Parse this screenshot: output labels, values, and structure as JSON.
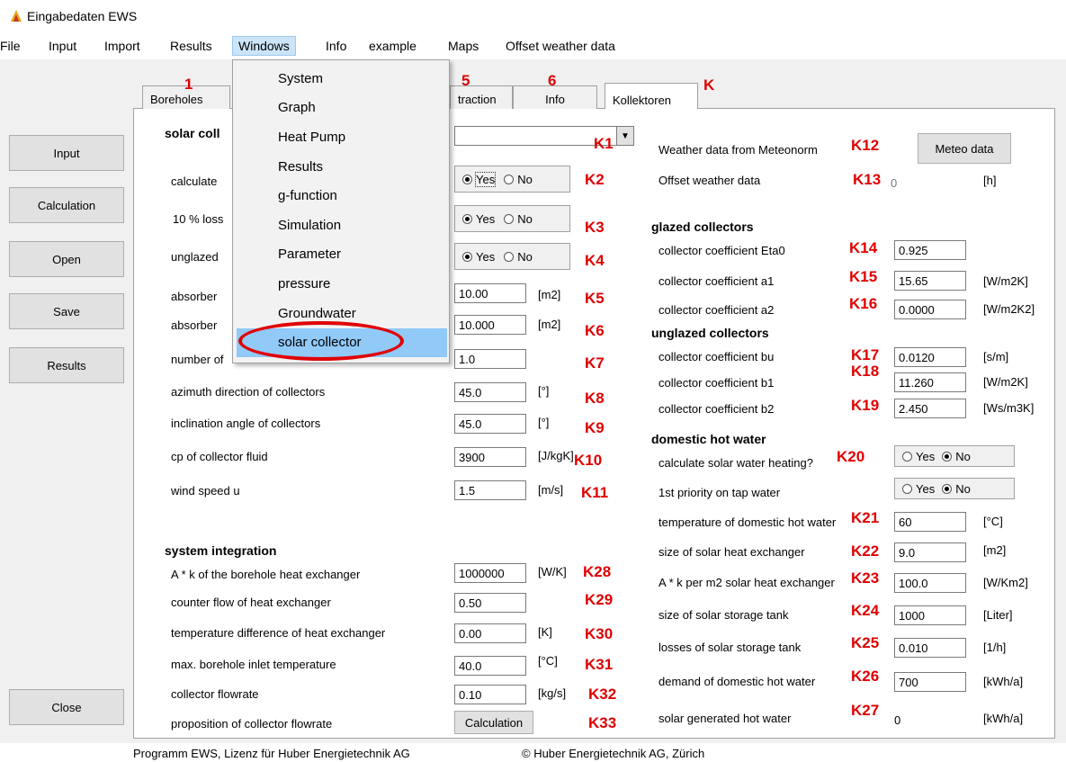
{
  "window": {
    "title": "Eingabedaten EWS"
  },
  "menu": [
    "File",
    "Input",
    "Import",
    "Results",
    "Windows",
    "Info",
    "example",
    "Maps",
    "Offset weather data"
  ],
  "windows_menu": [
    "System",
    "Graph",
    "Heat Pump",
    "Results",
    "g-function",
    "Simulation",
    "Parameter",
    "pressure",
    "Groundwater",
    "solar collector"
  ],
  "sidebar": {
    "input": "Input",
    "calculation": "Calculation",
    "open": "Open",
    "save": "Save",
    "results": "Results",
    "close": "Close"
  },
  "tabs": [
    "Boreholes",
    "traction",
    "Info",
    "Kollektoren"
  ],
  "tab_annotations": {
    "boreholes": "1",
    "traction": "5",
    "info": "6",
    "kollektoren": "K"
  },
  "left": {
    "section_title": "solar coll",
    "k1": "K1",
    "calculate": {
      "label": "calculate",
      "yes": "Yes",
      "no": "No",
      "anno": "K2",
      "selected": "Yes"
    },
    "loss": {
      "label": "10 % loss",
      "yes": "Yes",
      "no": "No",
      "anno": "K3",
      "selected": "Yes"
    },
    "unglazed": {
      "label": "unglazed",
      "yes": "Yes",
      "no": "No",
      "anno": "K4",
      "selected": "Yes"
    },
    "rows": [
      {
        "label": "absorber",
        "value": "10.00",
        "unit": "[m2]",
        "anno": "K5"
      },
      {
        "label": "absorber",
        "value": "10.000",
        "unit": "[m2]",
        "anno": "K6"
      },
      {
        "label": "number of",
        "value": "1.0",
        "unit": "",
        "anno": "K7"
      },
      {
        "label": "azimuth direction of collectors",
        "value": "45.0",
        "unit": "[°]",
        "anno": "K8"
      },
      {
        "label": "inclination angle of collectors",
        "value": "45.0",
        "unit": "[°]",
        "anno": "K9"
      },
      {
        "label": "cp of collector fluid",
        "value": "3900",
        "unit": "[J/kgK]",
        "anno": "K10"
      },
      {
        "label": "wind speed u",
        "value": "1.5",
        "unit": "[m/s]",
        "anno": "K11"
      }
    ],
    "system_title": "system integration",
    "sys_rows": [
      {
        "label": "A * k of the borehole heat exchanger",
        "value": "1000000",
        "unit": "[W/K]",
        "anno": "K28"
      },
      {
        "label": "counter flow of heat exchanger",
        "value": "0.50",
        "unit": "",
        "anno": "K29"
      },
      {
        "label": "temperature difference of heat exchanger",
        "value": "0.00",
        "unit": "[K]",
        "anno": "K30"
      },
      {
        "label": "max. borehole inlet temperature",
        "value": "40.0",
        "unit": "[°C]",
        "anno": "K31"
      },
      {
        "label": "collector flowrate",
        "value": "0.10",
        "unit": "[kg/s]",
        "anno": "K32"
      }
    ],
    "proposition": {
      "label": "proposition of collector flowrate",
      "button": "Calculation",
      "anno": "K33"
    }
  },
  "right": {
    "weather": {
      "label": "Weather data from Meteonorm",
      "anno": "K12",
      "button": "Meteo data"
    },
    "offset": {
      "label": "Offset weather data",
      "anno": "K13",
      "value": "0",
      "unit": "[h]"
    },
    "glazed_title": "glazed collectors",
    "glazed": [
      {
        "label": "collector coefficient Eta0",
        "anno": "K14",
        "value": "0.925",
        "unit": ""
      },
      {
        "label": "collector coefficient a1",
        "anno": "K15",
        "value": "15.65",
        "unit": "[W/m2K]"
      },
      {
        "label": "collector coefficient a2",
        "anno": "K16",
        "value": "0.0000",
        "unit": "[W/m2K2]"
      }
    ],
    "unglazed_title": "unglazed collectors",
    "unglazed": [
      {
        "label": "collector coefficient bu",
        "anno": "K17",
        "value": "0.0120",
        "unit": "[s/m]"
      },
      {
        "label": "collector coefficient b1",
        "anno": "K18",
        "value": "11.260",
        "unit": "[W/m2K]"
      },
      {
        "label": "collector coefficient b2",
        "anno": "K19",
        "value": "2.450",
        "unit": "[Ws/m3K]"
      }
    ],
    "dhw_title": "domestic hot water",
    "dhw_calc": {
      "label": "calculate solar water heating?",
      "anno": "K20",
      "yes": "Yes",
      "no": "No",
      "selected": "No"
    },
    "dhw_prio": {
      "label": "1st priority on tap water",
      "yes": "Yes",
      "no": "No",
      "selected": "No"
    },
    "dhw_rows": [
      {
        "label": "temperature of domestic hot water",
        "anno": "K21",
        "value": "60",
        "unit": "[°C]"
      },
      {
        "label": "size of solar heat exchanger",
        "anno": "K22",
        "value": "9.0",
        "unit": "[m2]"
      },
      {
        "label": "A * k per m2 solar heat exchanger",
        "anno": "K23",
        "value": "100.0",
        "unit": "[W/Km2]"
      },
      {
        "label": "size of solar storage tank",
        "anno": "K24",
        "value": "1000",
        "unit": "[Liter]"
      },
      {
        "label": "losses of solar storage tank",
        "anno": "K25",
        "value": "0.010",
        "unit": "[1/h]"
      },
      {
        "label": "demand of domestic hot water",
        "anno": "K26",
        "value": "700",
        "unit": "[kWh/a]"
      }
    ],
    "solar_hot": {
      "label": "solar generated hot water",
      "anno": "K27",
      "value": "0",
      "unit": "[kWh/a]"
    }
  },
  "status": {
    "left": "Programm EWS, Lizenz für Huber Energietechnik AG",
    "right": "© Huber Energietechnik AG, Zürich"
  },
  "colors": {
    "annotation": "#e00000",
    "highlight": "#91c9f7"
  }
}
